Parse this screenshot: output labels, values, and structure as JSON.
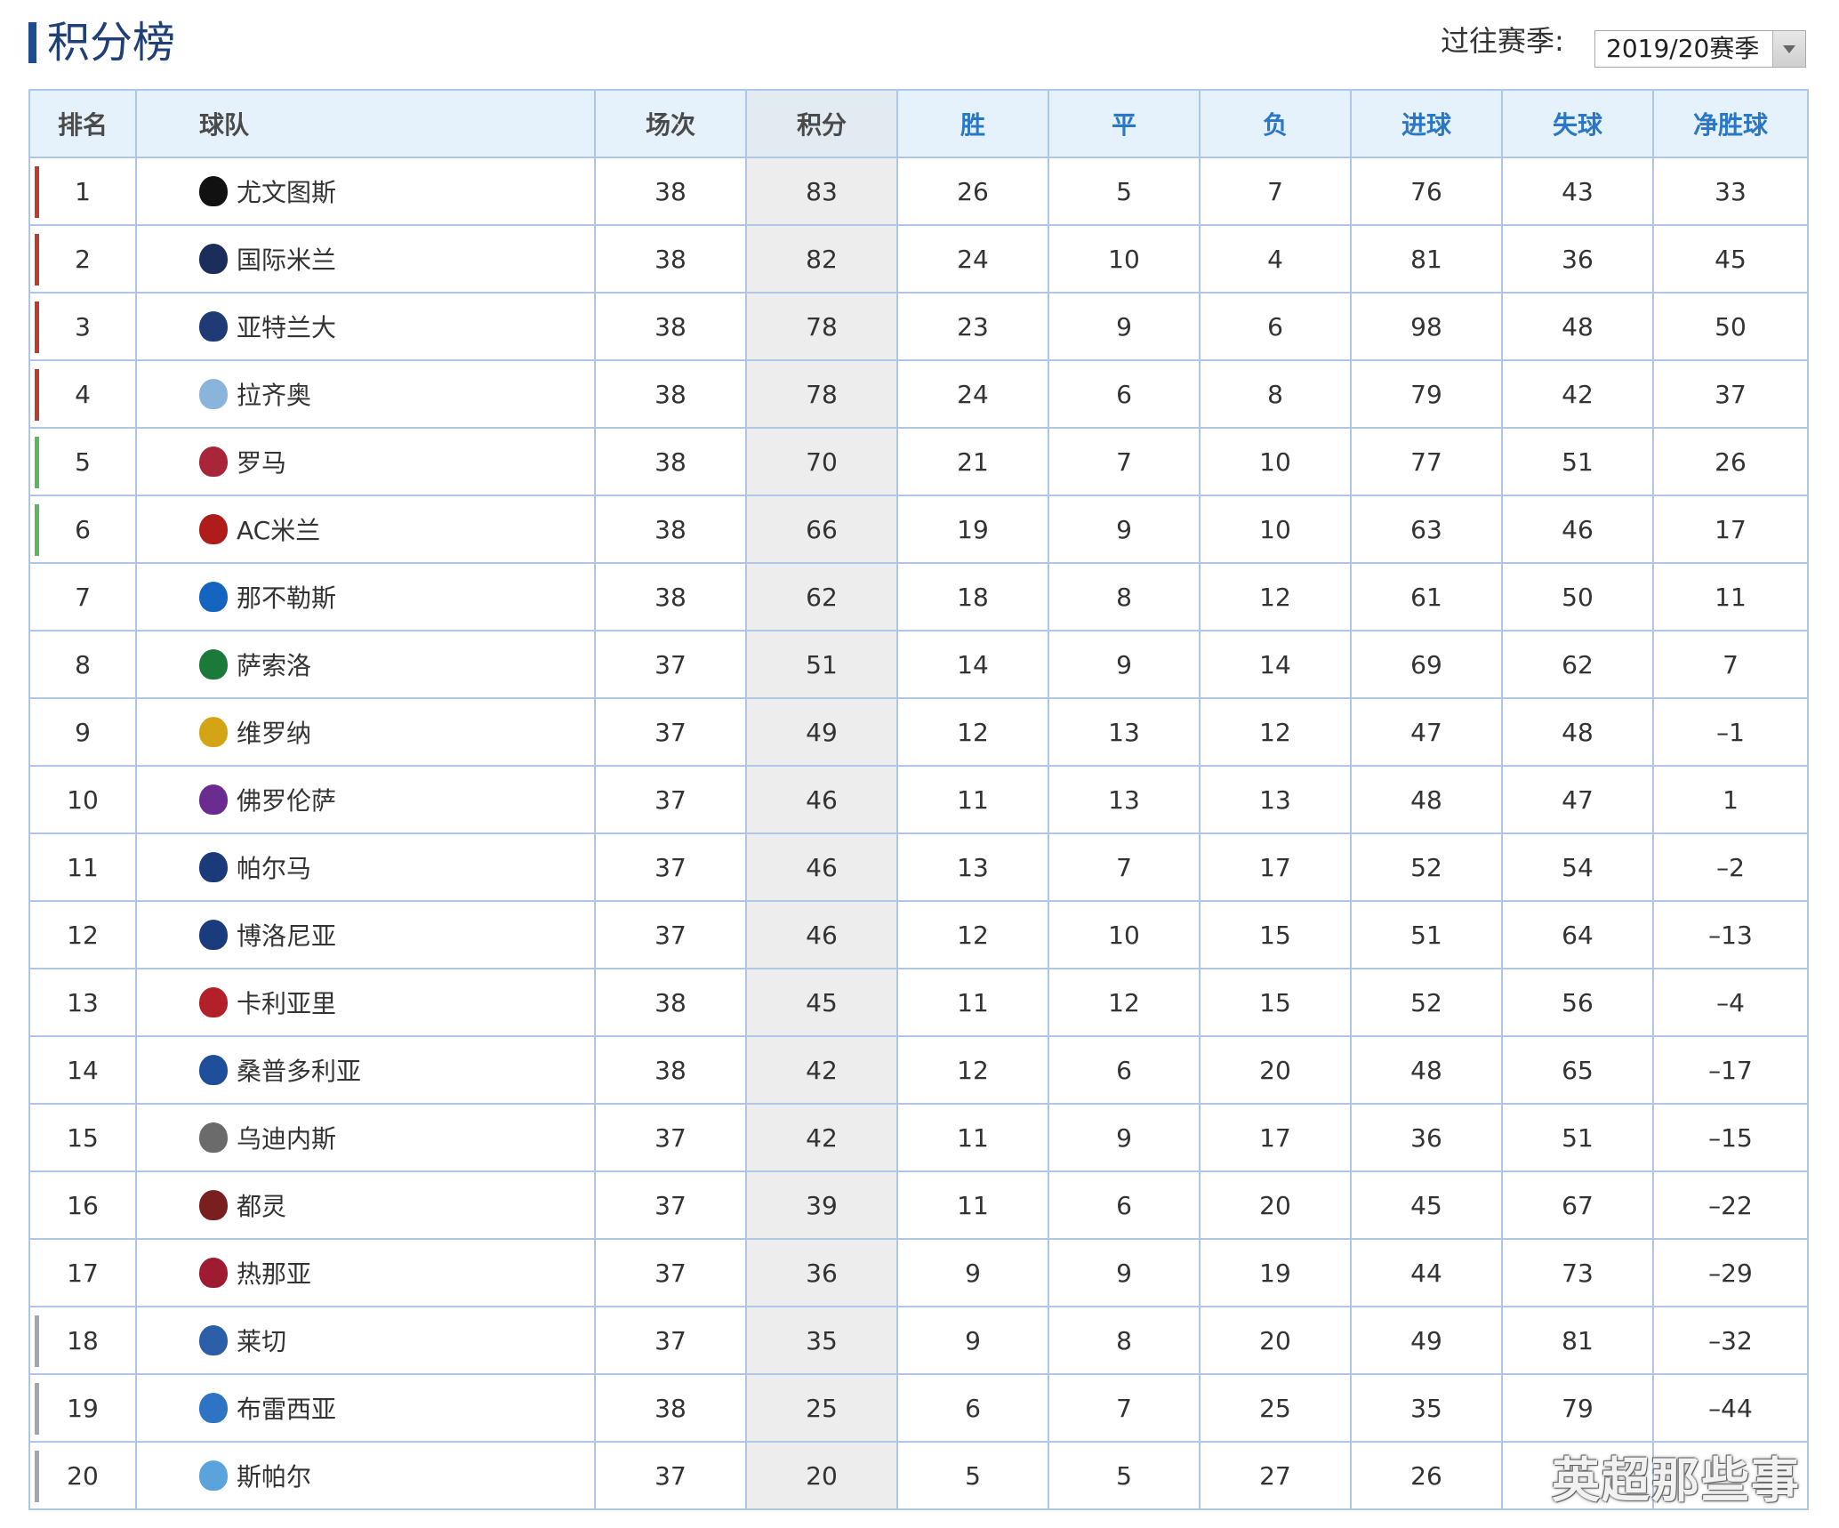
{
  "header": {
    "title": "积分榜",
    "season_label": "过往赛季:",
    "season_value": "2019/20赛季"
  },
  "columns": [
    "排名",
    "球队",
    "场次",
    "积分",
    "胜",
    "平",
    "负",
    "进球",
    "失球",
    "净胜球"
  ],
  "zone_colors": {
    "champions": "#c0392b",
    "europa": "#5cb85c",
    "relegation": "#a6a6a6",
    "none": ""
  },
  "rows": [
    {
      "rank": "1",
      "team": "尤文图斯",
      "played": "38",
      "points": "83",
      "won": "26",
      "drawn": "5",
      "lost": "7",
      "gf": "76",
      "ga": "43",
      "gd": "33",
      "zone": "champions",
      "logo": "juventus-logo",
      "logo_color": "#111111"
    },
    {
      "rank": "2",
      "team": "国际米兰",
      "played": "38",
      "points": "82",
      "won": "24",
      "drawn": "10",
      "lost": "4",
      "gf": "81",
      "ga": "36",
      "gd": "45",
      "zone": "champions",
      "logo": "inter-logo",
      "logo_color": "#1b2d5a"
    },
    {
      "rank": "3",
      "team": "亚特兰大",
      "played": "38",
      "points": "78",
      "won": "23",
      "drawn": "9",
      "lost": "6",
      "gf": "98",
      "ga": "48",
      "gd": "50",
      "zone": "champions",
      "logo": "atalanta-logo",
      "logo_color": "#1f3a75"
    },
    {
      "rank": "4",
      "team": "拉齐奥",
      "played": "38",
      "points": "78",
      "won": "24",
      "drawn": "6",
      "lost": "8",
      "gf": "79",
      "ga": "42",
      "gd": "37",
      "zone": "champions",
      "logo": "lazio-logo",
      "logo_color": "#8ab4d9"
    },
    {
      "rank": "5",
      "team": "罗马",
      "played": "38",
      "points": "70",
      "won": "21",
      "drawn": "7",
      "lost": "10",
      "gf": "77",
      "ga": "51",
      "gd": "26",
      "zone": "europa",
      "logo": "roma-logo",
      "logo_color": "#a8253a"
    },
    {
      "rank": "6",
      "team": "AC米兰",
      "played": "38",
      "points": "66",
      "won": "19",
      "drawn": "9",
      "lost": "10",
      "gf": "63",
      "ga": "46",
      "gd": "17",
      "zone": "europa",
      "logo": "ac-milan-logo",
      "logo_color": "#b01b1b"
    },
    {
      "rank": "7",
      "team": "那不勒斯",
      "played": "38",
      "points": "62",
      "won": "18",
      "drawn": "8",
      "lost": "12",
      "gf": "61",
      "ga": "50",
      "gd": "11",
      "zone": "none",
      "logo": "napoli-logo",
      "logo_color": "#1565c0"
    },
    {
      "rank": "8",
      "team": "萨索洛",
      "played": "37",
      "points": "51",
      "won": "14",
      "drawn": "9",
      "lost": "14",
      "gf": "69",
      "ga": "62",
      "gd": "7",
      "zone": "none",
      "logo": "sassuolo-logo",
      "logo_color": "#1b7a3a"
    },
    {
      "rank": "9",
      "team": "维罗纳",
      "played": "37",
      "points": "49",
      "won": "12",
      "drawn": "13",
      "lost": "12",
      "gf": "47",
      "ga": "48",
      "gd": "–1",
      "zone": "none",
      "logo": "verona-logo",
      "logo_color": "#d4a417"
    },
    {
      "rank": "10",
      "team": "佛罗伦萨",
      "played": "37",
      "points": "46",
      "won": "11",
      "drawn": "13",
      "lost": "13",
      "gf": "48",
      "ga": "47",
      "gd": "1",
      "zone": "none",
      "logo": "fiorentina-logo",
      "logo_color": "#6a2c91"
    },
    {
      "rank": "11",
      "team": "帕尔马",
      "played": "37",
      "points": "46",
      "won": "13",
      "drawn": "7",
      "lost": "17",
      "gf": "52",
      "ga": "54",
      "gd": "–2",
      "zone": "none",
      "logo": "parma-logo",
      "logo_color": "#1a3a7a"
    },
    {
      "rank": "12",
      "team": "博洛尼亚",
      "played": "37",
      "points": "46",
      "won": "12",
      "drawn": "10",
      "lost": "15",
      "gf": "51",
      "ga": "64",
      "gd": "–13",
      "zone": "none",
      "logo": "bologna-logo",
      "logo_color": "#1a3b7c"
    },
    {
      "rank": "13",
      "team": "卡利亚里",
      "played": "38",
      "points": "45",
      "won": "11",
      "drawn": "12",
      "lost": "15",
      "gf": "52",
      "ga": "56",
      "gd": "–4",
      "zone": "none",
      "logo": "cagliari-logo",
      "logo_color": "#b3202a"
    },
    {
      "rank": "14",
      "team": "桑普多利亚",
      "played": "38",
      "points": "42",
      "won": "12",
      "drawn": "6",
      "lost": "20",
      "gf": "48",
      "ga": "65",
      "gd": "–17",
      "zone": "none",
      "logo": "sampdoria-logo",
      "logo_color": "#1f4f9a"
    },
    {
      "rank": "15",
      "team": "乌迪内斯",
      "played": "37",
      "points": "42",
      "won": "11",
      "drawn": "9",
      "lost": "17",
      "gf": "36",
      "ga": "51",
      "gd": "–15",
      "zone": "none",
      "logo": "udinese-logo",
      "logo_color": "#6b6b6b"
    },
    {
      "rank": "16",
      "team": "都灵",
      "played": "37",
      "points": "39",
      "won": "11",
      "drawn": "6",
      "lost": "20",
      "gf": "45",
      "ga": "67",
      "gd": "–22",
      "zone": "none",
      "logo": "torino-logo",
      "logo_color": "#7a1f1f"
    },
    {
      "rank": "17",
      "team": "热那亚",
      "played": "37",
      "points": "36",
      "won": "9",
      "drawn": "9",
      "lost": "19",
      "gf": "44",
      "ga": "73",
      "gd": "–29",
      "zone": "none",
      "logo": "genoa-logo",
      "logo_color": "#9e1b32"
    },
    {
      "rank": "18",
      "team": "莱切",
      "played": "37",
      "points": "35",
      "won": "9",
      "drawn": "8",
      "lost": "20",
      "gf": "49",
      "ga": "81",
      "gd": "–32",
      "zone": "relegation",
      "logo": "lecce-logo",
      "logo_color": "#2d5fa8"
    },
    {
      "rank": "19",
      "team": "布雷西亚",
      "played": "38",
      "points": "25",
      "won": "6",
      "drawn": "7",
      "lost": "25",
      "gf": "35",
      "ga": "79",
      "gd": "–44",
      "zone": "relegation",
      "logo": "brescia-logo",
      "logo_color": "#2f73c4"
    },
    {
      "rank": "20",
      "team": "斯帕尔",
      "played": "37",
      "points": "20",
      "won": "5",
      "drawn": "5",
      "lost": "27",
      "gf": "26",
      "ga": "",
      "gd": "",
      "zone": "relegation",
      "logo": "spal-logo",
      "logo_color": "#5aa3dc"
    }
  ],
  "watermark": "英超那些事"
}
